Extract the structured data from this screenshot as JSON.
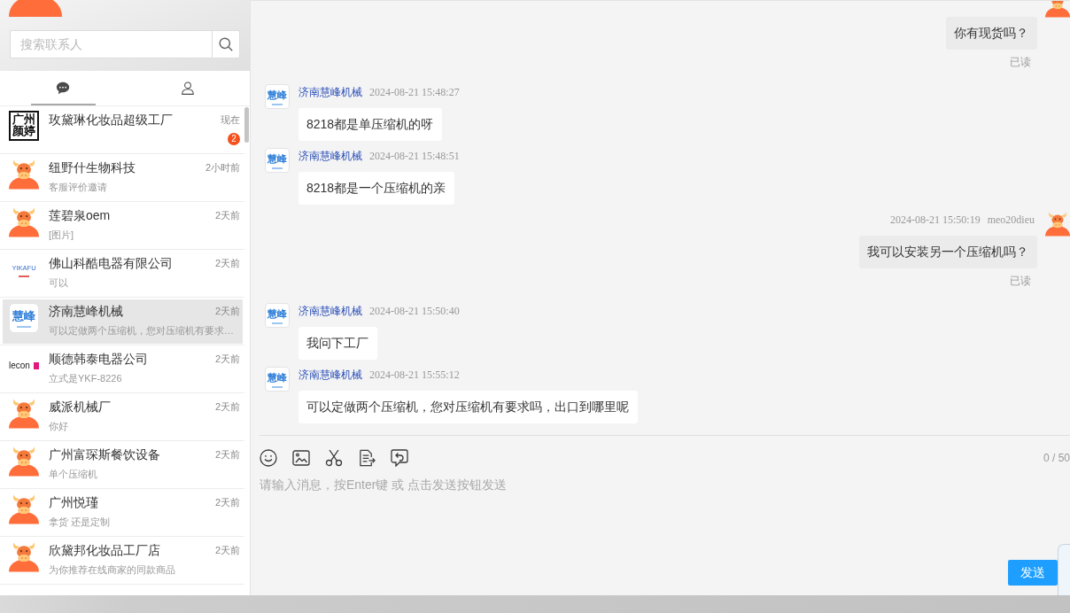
{
  "sidebar": {
    "search": {
      "placeholder": "搜索联系人"
    },
    "tabs": [
      {
        "kind": "chats",
        "selected": true
      },
      {
        "kind": "contacts",
        "selected": false
      }
    ],
    "contacts": [
      {
        "name": "玫黛琳化妆品超级工厂",
        "time": "现在",
        "badge": "2",
        "selected": false,
        "avatar": {
          "kind": "boxed-text",
          "text": "广州颜婷"
        }
      },
      {
        "name": "纽野什生物科技",
        "time": "2小时前",
        "preview": "客服评价邀请",
        "selected": false,
        "avatar": {
          "kind": "bull"
        }
      },
      {
        "name": "莲碧泉oem",
        "time": "2天前",
        "preview": "[图片]",
        "selected": false,
        "avatar": {
          "kind": "bull"
        }
      },
      {
        "name": "佛山科酷电器有限公司",
        "time": "2天前",
        "preview": "可以",
        "selected": false,
        "avatar": {
          "kind": "blue-wordmark",
          "text": "YIKAFU"
        }
      },
      {
        "name": "济南慧峰机械",
        "time": "2天前",
        "preview": "可以定做两个压缩机，您对压缩机有要求…",
        "selected": true,
        "avatar": {
          "kind": "brush-logo",
          "text": "慧峰"
        }
      },
      {
        "name": "顺德韩泰电器公司",
        "time": "2天前",
        "preview": "立式是YKF-8226",
        "selected": false,
        "avatar": {
          "kind": "dark-wordmark",
          "text": "lecon"
        }
      },
      {
        "name": "威派机械厂",
        "time": "2天前",
        "preview": "你好",
        "selected": false,
        "avatar": {
          "kind": "bull"
        }
      },
      {
        "name": "广州富琛斯餐饮设备",
        "time": "2天前",
        "preview": "单个压缩机",
        "selected": false,
        "avatar": {
          "kind": "bull"
        }
      },
      {
        "name": "广州悦瑾",
        "time": "2天前",
        "preview": "拿货 还是定制",
        "selected": false,
        "avatar": {
          "kind": "bull"
        }
      },
      {
        "name": "欣黛邦化妆品工厂店",
        "time": "2天前",
        "preview": "为你推荐在线商家的同款商品",
        "selected": false,
        "avatar": {
          "kind": "bull"
        }
      }
    ]
  },
  "chat": {
    "messages": [
      {
        "kind": "outgoing",
        "avatar": {
          "kind": "bull"
        },
        "text": "你有现货吗？",
        "status": "已读"
      },
      {
        "kind": "incoming",
        "avatar": {
          "kind": "brush-logo",
          "text": "慧峰"
        },
        "sender": "济南慧峰机械",
        "time": "2024-08-21 15:48:27",
        "text": "8218都是单压缩机的呀"
      },
      {
        "kind": "incoming",
        "avatar": {
          "kind": "brush-logo",
          "text": "慧峰"
        },
        "sender": "济南慧峰机械",
        "time": "2024-08-21 15:48:51",
        "text": "8218都是一个压缩机的亲"
      },
      {
        "kind": "outgoing",
        "avatar": {
          "kind": "bull"
        },
        "time": "2024-08-21 15:50:19",
        "sender": "meo20dieu",
        "text": "我可以安装另一个压缩机吗？",
        "status": "已读"
      },
      {
        "kind": "incoming",
        "avatar": {
          "kind": "brush-logo",
          "text": "慧峰"
        },
        "sender": "济南慧峰机械",
        "time": "2024-08-21 15:50:40",
        "text": "我问下工厂"
      },
      {
        "kind": "incoming",
        "avatar": {
          "kind": "brush-logo",
          "text": "慧峰"
        },
        "sender": "济南慧峰机械",
        "time": "2024-08-21 15:55:12",
        "text": "可以定做两个压缩机，您对压缩机有要求吗，出口到哪里呢"
      }
    ],
    "composer": {
      "counter": "0 / 50",
      "placeholder": "请输入消息，按Enter键 或 点击发送按钮发送",
      "send_button": "发送"
    }
  }
}
